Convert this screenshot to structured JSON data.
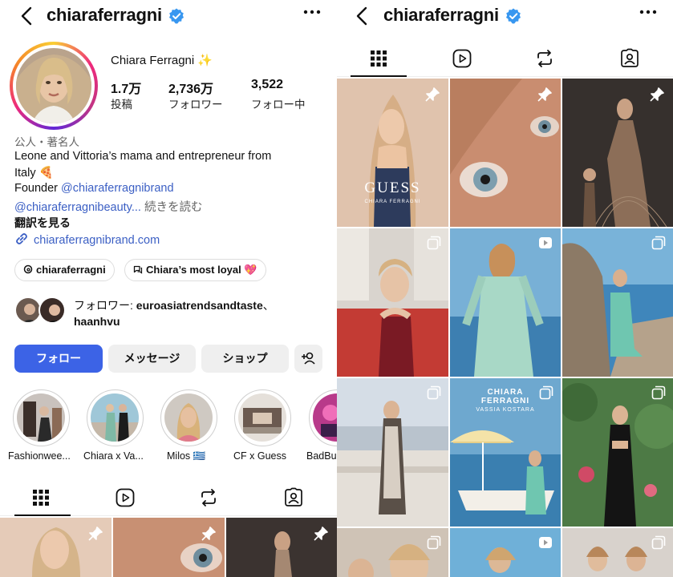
{
  "profile": {
    "username": "chiaraferragni",
    "display_name": "Chiara Ferragni",
    "sparkle": "✨",
    "stats": [
      {
        "num": "1.7万",
        "label": "投稿"
      },
      {
        "num": "2,736万",
        "label": "フォロワー"
      },
      {
        "num": "3,522",
        "label": "フォロー中"
      }
    ],
    "category": "公人・著名人",
    "bio_line1": "Leone and Vittoria’s mama and entrepreneur from",
    "bio_line2": "Italy 🍕",
    "founder_label": "Founder ",
    "founder_link": "@chiaraferragnibrand",
    "beauty_link": "@chiaraferragnibeauty...",
    "more_text": " 続きを読む",
    "translate": "翻訳を見る",
    "website": "chiaraferragnibrand.com",
    "threads_pill": "chiaraferragni",
    "channel_pill": "Chiara’s most loyal 💖",
    "followed_by_prefix": "フォロワー: ",
    "followed_by_names": "euroasiatrendsandtaste",
    "followed_by_suffix": "、",
    "followed_by_line2": "haanhvu"
  },
  "buttons": {
    "follow": "フォロー",
    "message": "メッセージ",
    "shop": "ショップ"
  },
  "highlights": [
    {
      "label": "Fashionwee..."
    },
    {
      "label": "Chiara x Va..."
    },
    {
      "label": "Milos 🇬🇷"
    },
    {
      "label": "CF x Guess"
    },
    {
      "label": "BadBu"
    }
  ],
  "posts": {
    "guess_logo": "GUESS",
    "guess_sub": "CHIARA FERRAGNI",
    "collab_title_1": "CHIARA",
    "collab_title_2": "FERRAGNI",
    "collab_sub": "VASSIA KOSTARA"
  },
  "colors": {
    "follow_blue": "#3c63e6",
    "link_blue": "#3b5fc4",
    "verified_blue": "#3897f0"
  }
}
